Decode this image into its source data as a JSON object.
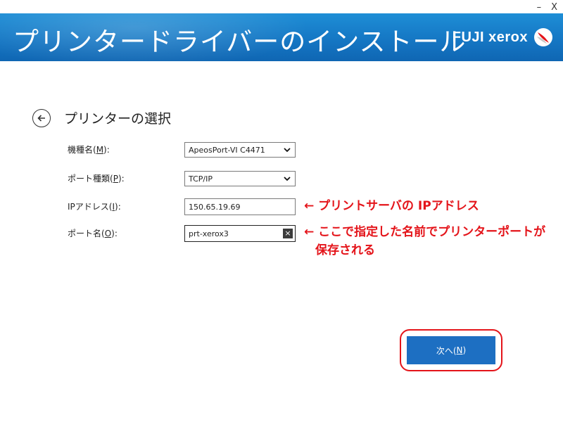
{
  "window": {
    "minimize": "–",
    "close": "X"
  },
  "header": {
    "title": "プリンタードライバーのインストール",
    "brand": "FUJI xerox"
  },
  "page": {
    "section_title": "プリンターの選択"
  },
  "form": {
    "model": {
      "label_pre": "機種名(",
      "label_key": "M",
      "label_post": "):",
      "value": "ApeosPort-VI C4471"
    },
    "port_type": {
      "label_pre": "ポート種類(",
      "label_key": "P",
      "label_post": "):",
      "value": "TCP/IP"
    },
    "ip_address": {
      "label_pre": "IPアドレス(",
      "label_key": "I",
      "label_post": "):",
      "value": "150.65.19.69"
    },
    "port_name": {
      "label_pre": "ポート名(",
      "label_key": "O",
      "label_post": "):",
      "value": "prt-xerox3"
    }
  },
  "annotations": {
    "ip_note": "← プリントサーバの IPアドレス",
    "port_note_line1": "← ここで指定した名前でプリンターポートが",
    "port_note_line2": "保存される"
  },
  "footer": {
    "next_pre": "次へ(",
    "next_key": "N",
    "next_post": ")"
  },
  "colors": {
    "banner": "#1577c4",
    "accent": "#1d6fc2",
    "annotation": "#e4141a"
  }
}
